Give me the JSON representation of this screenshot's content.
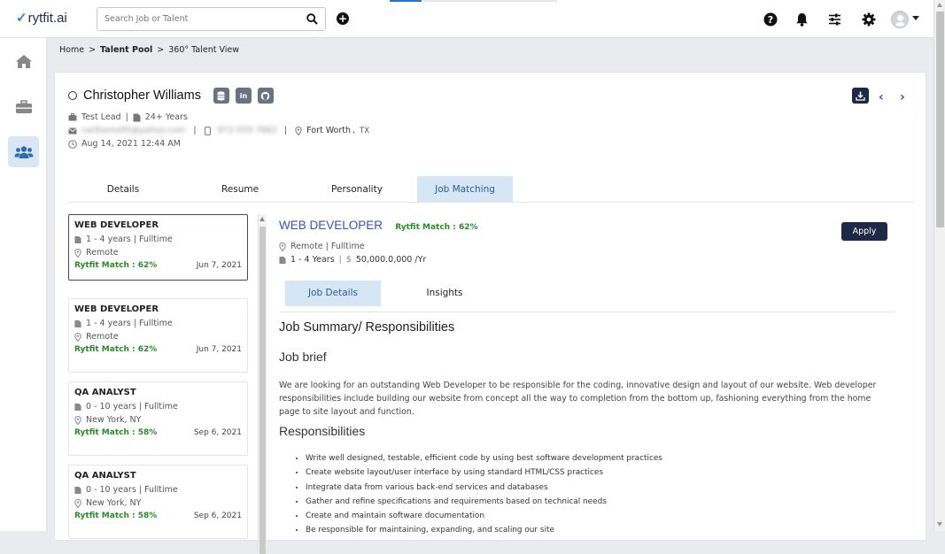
{
  "app": {
    "logo_text": "rytfit.ai"
  },
  "topbar": {
    "search_placeholder": "Search Job or Talent",
    "icons": [
      "search-icon",
      "plus-circle-icon",
      "help-icon",
      "bell-icon",
      "filter-sliders-icon",
      "gear-icon",
      "user-avatar",
      "chevron-down-icon"
    ]
  },
  "sidebar": {
    "items": [
      {
        "name": "home",
        "icon": "home-icon"
      },
      {
        "name": "jobs",
        "icon": "briefcase-icon"
      },
      {
        "name": "talent",
        "icon": "users-icon",
        "active": true
      }
    ]
  },
  "breadcrumb": {
    "home": "Home",
    "sep": ">",
    "talent_pool": "Talent Pool",
    "current": "360° Talent View"
  },
  "candidate": {
    "name": "Christopher Williams",
    "title": "Test Lead",
    "experience": "24+ Years",
    "email": "cwilliams95@yahoo.com",
    "phone": "972-555-7862",
    "city": "Fort Worth",
    "state_sep": ",",
    "state": "TX",
    "date": "Aug 14, 2021 12:44 AM",
    "sep": "|"
  },
  "profile_tabs": [
    "Details",
    "Resume",
    "Personality",
    "Job Matching"
  ],
  "active_profile_tab": "Job Matching",
  "job_list": [
    {
      "title": "WEB DEVELOPER",
      "exp_type": "1 - 4 years | Fulltime",
      "location": "Remote",
      "match": "Rytfit Match : 62%",
      "date": "Jun 7, 2021",
      "selected": true
    },
    {
      "title": "WEB DEVELOPER",
      "exp_type": "1 - 4 years | Fulltime",
      "location": "Remote",
      "match": "Rytfit Match : 62%",
      "date": "Jun 7, 2021"
    },
    {
      "title": "QA ANALYST",
      "exp_type": "0 - 10 years | Fulltime",
      "location": "New York, NY",
      "match": "Rytfit Match : 58%",
      "date": "Sep 6, 2021"
    },
    {
      "title": "QA ANALYST",
      "exp_type": "0 - 10 years | Fulltime",
      "location": "New York, NY",
      "match": "Rytfit Match : 58%",
      "date": "Sep 6, 2021"
    }
  ],
  "job_detail": {
    "title": "WEB DEVELOPER",
    "match": "Rytfit Match : 62%",
    "location_type": "Remote | Fulltime",
    "experience": "1 - 4 Years",
    "sep": "|",
    "salary": "50,000.0,000 /Yr",
    "apply_label": "Apply",
    "tabs": [
      "Job Details",
      "Insights"
    ],
    "active_tab": "Job Details",
    "summary_heading": "Job Summary/ Responsibilities",
    "brief_heading": "Job brief",
    "brief_text": "We are looking for an outstanding Web Developer to be responsible for the coding, innovative design and layout of our website. Web developer responsibilities include building our website from concept all the way to completion from the bottom up, fashioning everything from the home page to site layout and function.",
    "responsibilities_heading": "Responsibilities",
    "responsibilities": [
      "Write well designed, testable, efficient code by using best software development practices",
      "Create website layout/user interface by using standard HTML/CSS practices",
      "Integrate data from various back-end services and databases",
      "Gather and refine specifications and requirements based on technical needs",
      "Create and maintain software documentation",
      "Be responsible for maintaining, expanding, and scaling our site"
    ]
  },
  "colors": {
    "accent": "#1d2945",
    "link": "#3b4dc6",
    "match_green": "#2a8a2a",
    "active_tab": "#d6e6f4"
  }
}
